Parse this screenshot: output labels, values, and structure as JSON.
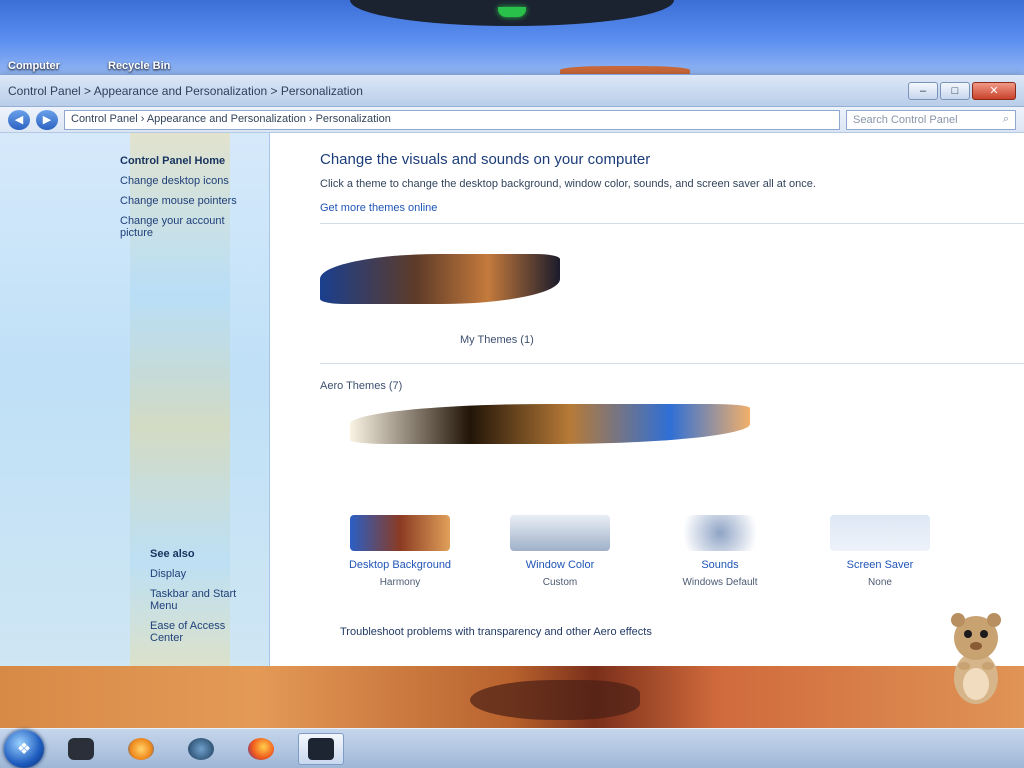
{
  "desktop": {
    "shortcuts": [
      "Computer",
      "Recycle Bin"
    ]
  },
  "window": {
    "title": "Control Panel > Appearance and Personalization > Personalization",
    "controls": {
      "minimize": "–",
      "maximize": "□",
      "close": "✕"
    }
  },
  "addressbar": {
    "back": "◀",
    "forward": "▶",
    "path": "Control Panel › Appearance and Personalization › Personalization",
    "search_placeholder": "Search Control Panel"
  },
  "sidebar": {
    "items": [
      {
        "label": "Control Panel Home"
      },
      {
        "label": "Change desktop icons"
      },
      {
        "label": "Change mouse pointers"
      },
      {
        "label": "Change your account picture"
      }
    ],
    "see_also_title": "See also",
    "see_also": [
      {
        "label": "Display"
      },
      {
        "label": "Taskbar and Start Menu"
      },
      {
        "label": "Ease of Access Center"
      }
    ]
  },
  "content": {
    "title": "Change the visuals and sounds on your computer",
    "description": "Click a theme to change the desktop background, window color, sounds, and screen saver all at once.",
    "manage_link": "Get more themes online",
    "my_themes_label": "My Themes (1)",
    "installed_themes_label": "Aero Themes (7)",
    "options": [
      {
        "label": "Desktop Background",
        "sub": "Harmony"
      },
      {
        "label": "Window Color",
        "sub": "Custom"
      },
      {
        "label": "Sounds",
        "sub": "Windows Default"
      },
      {
        "label": "Screen Saver",
        "sub": "None"
      }
    ],
    "footer_hint": "Troubleshoot problems with transparency and other Aero effects"
  },
  "taskbar": {
    "start_icon": "windows-logo",
    "buttons": [
      "explorer",
      "media-player",
      "network",
      "firefox",
      "control-panel"
    ],
    "clock": {
      "time": "",
      "date": ""
    }
  },
  "colors": {
    "accent": "#1f55b6",
    "sidebar_bg": "#bfe0f7",
    "taskbar": "#9fb7d6"
  }
}
